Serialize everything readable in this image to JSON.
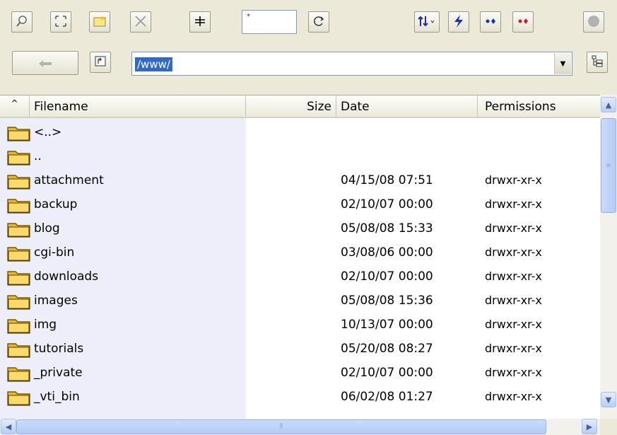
{
  "toolbar": {
    "buttons": [
      {
        "icon": "find-icon",
        "glyph": "⚲"
      },
      {
        "icon": "select-all-icon",
        "glyph": "⛶"
      },
      {
        "icon": "new-folder-icon",
        "glyph": "✦"
      },
      {
        "icon": "delete-icon",
        "glyph": "✕"
      },
      {
        "icon": "add-icon",
        "glyph": "╪"
      }
    ],
    "filter_text": "*",
    "refresh_icon": "refresh-icon",
    "right_buttons": [
      {
        "icon": "sort-icon",
        "glyph": "⇅"
      },
      {
        "icon": "lightning-icon",
        "glyph": "ϟ"
      },
      {
        "icon": "connect-icon",
        "glyph": "•⬩"
      },
      {
        "icon": "disconnect-icon",
        "glyph": "•⬩"
      },
      {
        "icon": "stop-icon",
        "glyph": "⬤"
      }
    ]
  },
  "navigation": {
    "path": "/www/"
  },
  "list": {
    "columns": {
      "sort_indicator": "^",
      "filename": "Filename",
      "size": "Size",
      "date": "Date",
      "permissions": "Permissions"
    },
    "rows": [
      {
        "name": "<..>",
        "date": "",
        "perms": ""
      },
      {
        "name": "..",
        "date": "",
        "perms": ""
      },
      {
        "name": "attachment",
        "date": "04/15/08  07:51",
        "perms": "drwxr-xr-x"
      },
      {
        "name": "backup",
        "date": "02/10/07  00:00",
        "perms": "drwxr-xr-x"
      },
      {
        "name": "blog",
        "date": "05/08/08  15:33",
        "perms": "drwxr-xr-x"
      },
      {
        "name": "cgi-bin",
        "date": "03/08/06  00:00",
        "perms": "drwxr-xr-x"
      },
      {
        "name": "downloads",
        "date": "02/10/07  00:00",
        "perms": "drwxr-xr-x"
      },
      {
        "name": "images",
        "date": "05/08/08  15:36",
        "perms": "drwxr-xr-x"
      },
      {
        "name": "img",
        "date": "10/13/07  00:00",
        "perms": "drwxr-xr-x"
      },
      {
        "name": "tutorials",
        "date": "05/20/08  08:27",
        "perms": "drwxr-xr-x"
      },
      {
        "name": "_private",
        "date": "02/10/07  00:00",
        "perms": "drwxr-xr-x"
      },
      {
        "name": "_vti_bin",
        "date": "06/02/08  01:27",
        "perms": "drwxr-xr-x"
      }
    ]
  },
  "colors": {
    "folder": "#f2c84b",
    "selection": "#316ac5",
    "name_column": "#eeeefa"
  }
}
